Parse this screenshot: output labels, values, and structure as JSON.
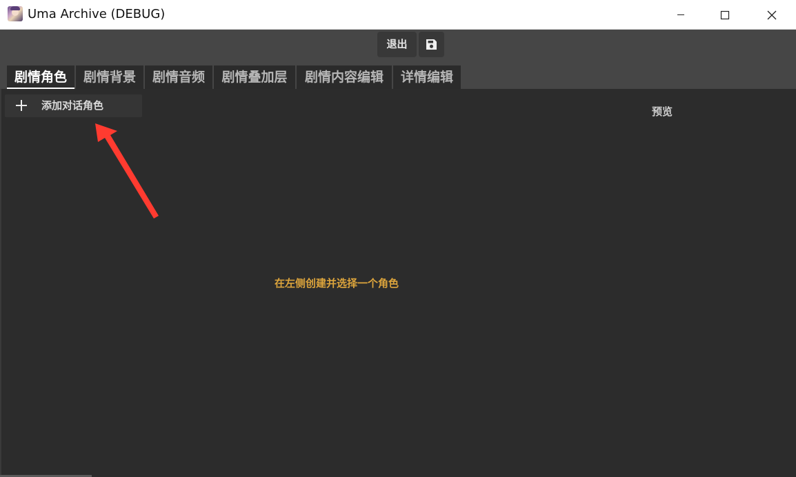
{
  "window": {
    "title": "Uma Archive (DEBUG)",
    "icon": "app-avatar-icon",
    "controls": [
      "minimize-icon",
      "maximize-icon",
      "close-icon"
    ]
  },
  "toolbar": {
    "exit_label": "退出",
    "save_icon": "save-icon"
  },
  "tabs": [
    {
      "label": "剧情角色",
      "active": true
    },
    {
      "label": "剧情背景",
      "active": false
    },
    {
      "label": "剧情音频",
      "active": false
    },
    {
      "label": "剧情叠加层",
      "active": false
    },
    {
      "label": "剧情内容编辑",
      "active": false
    },
    {
      "label": "详情编辑",
      "active": false
    }
  ],
  "sidebar": {
    "add_icon": "plus-icon",
    "add_label": "添加对话角色"
  },
  "preview": {
    "label": "预览"
  },
  "main": {
    "hint": "在左侧创建并选择一个角色"
  },
  "annotation": {
    "icon": "red-arrow-icon",
    "color": "#ff3b30"
  },
  "colors": {
    "hint": "#dca43c",
    "background": "#2c2c2c",
    "toolbar": "#464646"
  }
}
